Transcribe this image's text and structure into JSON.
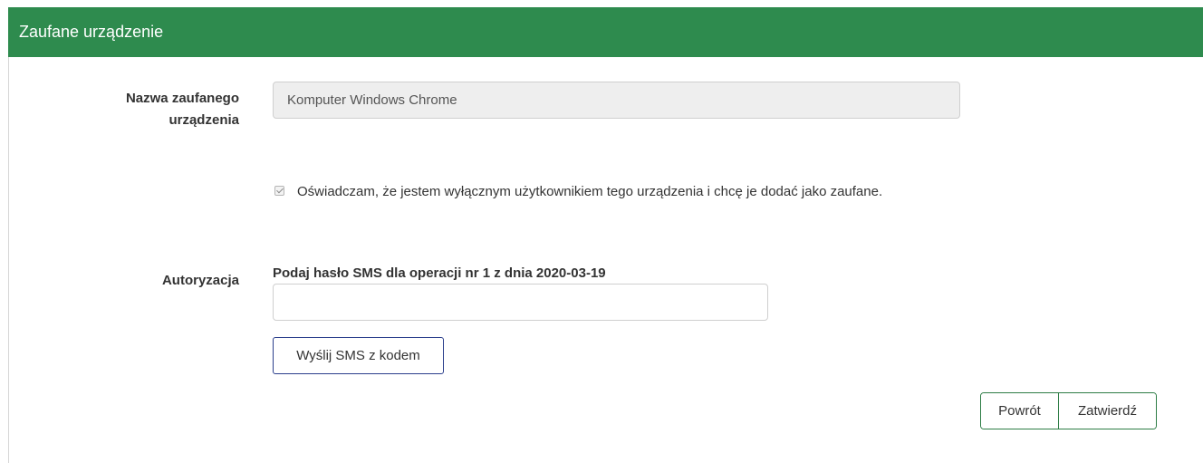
{
  "header": {
    "title": "Zaufane urządzenie"
  },
  "form": {
    "device_name_label": "Nazwa zaufanego urządzenia",
    "device_name_value": "Komputer Windows Chrome",
    "declaration_checked": true,
    "declaration_text": "Oświadczam, że jestem wyłącznym użytkownikiem tego urządzenia i chcę je dodać jako zaufane.",
    "authorization_label": "Autoryzacja",
    "sms_prompt": "Podaj hasło SMS dla operacji nr 1 z dnia 2020-03-19",
    "sms_code_value": "",
    "send_sms_label": "Wyślij SMS z kodem"
  },
  "actions": {
    "back_label": "Powrót",
    "confirm_label": "Zatwierdź"
  },
  "colors": {
    "header_bg": "#2e8b4e",
    "action_border": "#2e7d46",
    "sms_button_border": "#2b3f8c"
  }
}
